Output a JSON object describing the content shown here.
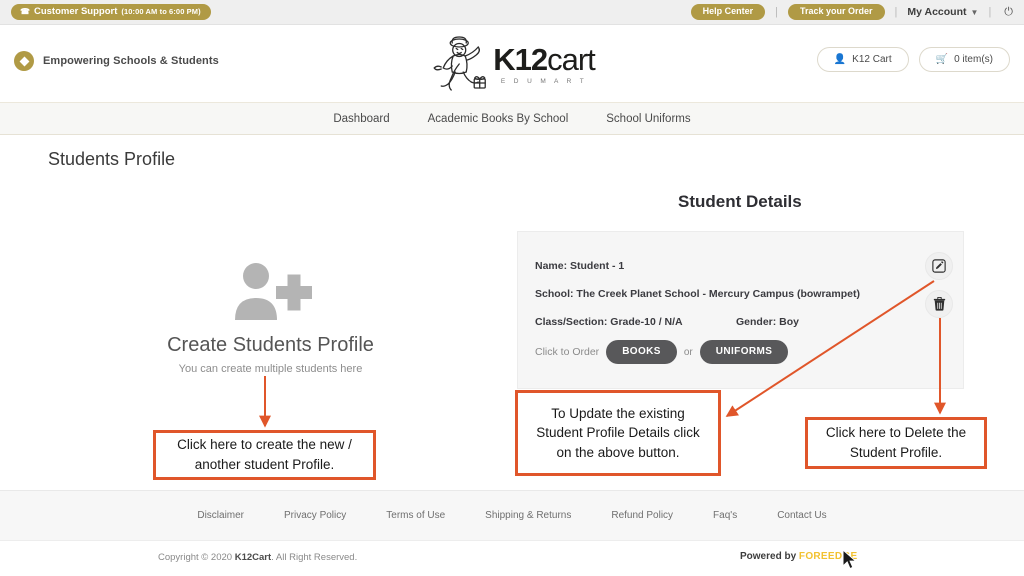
{
  "topbar": {
    "support_label": "Customer Support",
    "support_hours": "(10:00 AM to 6:00 PM)",
    "phone_icon": "phone-icon",
    "help_center": "Help Center",
    "track_order": "Track your Order",
    "my_account": "My Account",
    "caret": "∨",
    "power_icon": "⏻",
    "gold": "#b09a45"
  },
  "header": {
    "tagline": "Empowering Schools & Students",
    "logo_main_1": "K12",
    "logo_main_2": "cart",
    "logo_sub": "E D U M A R T",
    "cart_account_btn": "K12 Cart",
    "cart_items_btn": "0 item(s)",
    "user_icon": "user-icon",
    "basket_icon": "basket-icon"
  },
  "nav": {
    "items": [
      {
        "label": "Dashboard"
      },
      {
        "label": "Academic Books By School"
      },
      {
        "label": "School Uniforms"
      }
    ]
  },
  "page": {
    "title": "Students Profile"
  },
  "create_panel": {
    "icon": "add-person-icon",
    "title": "Create Students Profile",
    "subtitle": "You can create multiple students here"
  },
  "student_details": {
    "heading": "Student Details",
    "name": "Name: Student - 1",
    "school": "School: The Creek Planet School - Mercury Campus (bowrampet)",
    "class_section": "Class/Section: Grade-10 / N/A",
    "gender": "Gender: Boy",
    "order_prefix": "Click to Order",
    "books_btn": "BOOKS",
    "or_label": "or",
    "uniforms_btn": "UNIFORMS",
    "edit_icon": "edit-pencil-icon",
    "delete_icon": "trash-icon"
  },
  "annotations": {
    "color": "#e0562a",
    "create": {
      "line1": "Click here to create the new /",
      "line2": "another student Profile."
    },
    "update": {
      "line1": "To Update the existing",
      "line2": "Student Profile Details click",
      "line3": "on the above button."
    },
    "delete": {
      "line1": "Click here to Delete the",
      "line2": "Student Profile."
    }
  },
  "footer": {
    "links": [
      {
        "label": "Disclaimer"
      },
      {
        "label": "Privacy Policy"
      },
      {
        "label": "Terms of Use"
      },
      {
        "label": "Shipping & Returns"
      },
      {
        "label": "Refund Policy"
      },
      {
        "label": "Faq's"
      },
      {
        "label": "Contact Us"
      }
    ],
    "copyright_pre": "Copyright © 2020 ",
    "copyright_brand": "K12Cart",
    "copyright_post": ". All Right Reserved.",
    "powered_pre": "Powered by ",
    "powered_brand": "FOREEDGE",
    "powered_brand_color": "#f2c230"
  }
}
